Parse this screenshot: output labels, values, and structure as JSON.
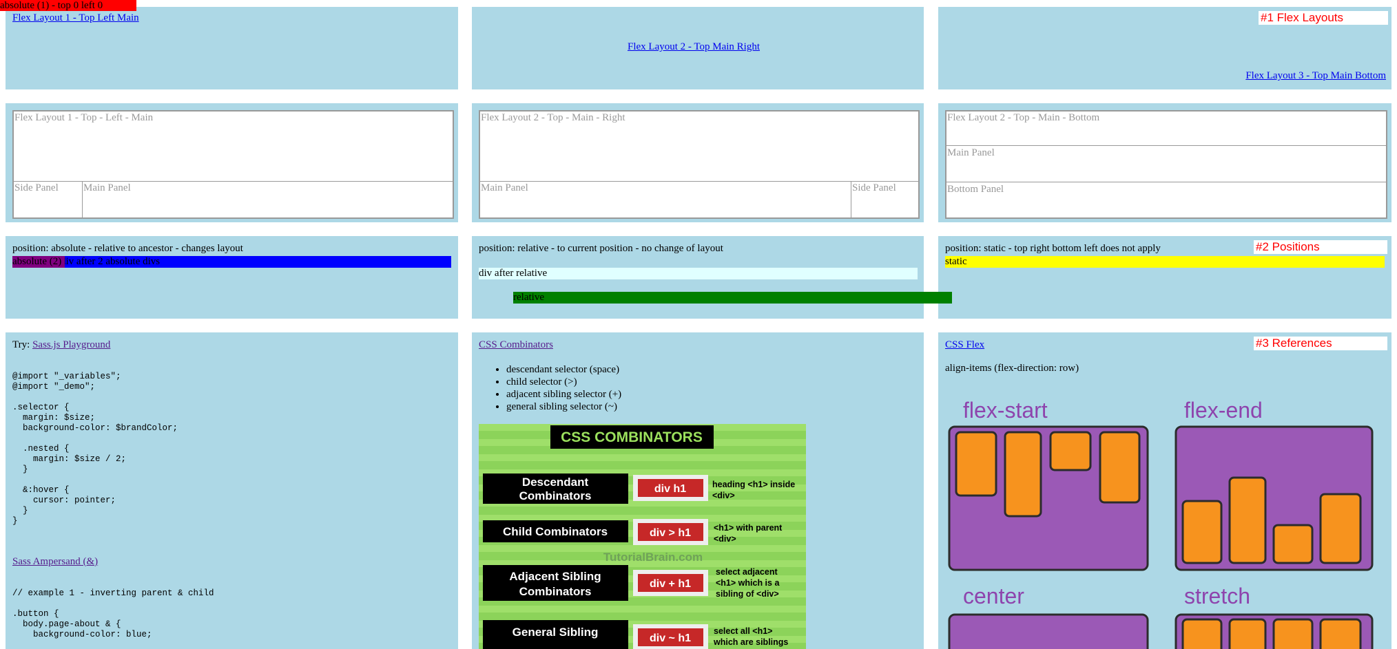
{
  "absolute_marker": "absolute (1) - top 0 left 0",
  "section_tags": {
    "flex": "#1 Flex Layouts",
    "positions": "#2 Positions",
    "references": "#3 References"
  },
  "flex_links": {
    "one": "Flex Layout 1 - Top Left Main",
    "two": "Flex Layout 2 - Top Main Right",
    "three": "Flex Layout 3 - Top Main Bottom"
  },
  "layouts": {
    "one": {
      "top": "Flex Layout 1 - Top - Left - Main",
      "side": "Side Panel",
      "main": "Main Panel"
    },
    "two": {
      "top": "Flex Layout 2 - Top - Main - Right",
      "main": "Main Panel",
      "side": "Side Panel"
    },
    "three": {
      "top": "Flex Layout 2 - Top - Main - Bottom",
      "main": "Main Panel",
      "bottom": "Bottom Panel"
    }
  },
  "positions": {
    "absolute": {
      "heading": "position: absolute - relative to ancestor - changes layout",
      "label": "absolute (2)",
      "after": "div after 2 absolute divs"
    },
    "relative": {
      "heading": "position: relative - to current position - no change of layout",
      "after": "div after relative",
      "label": "relative"
    },
    "static": {
      "heading": "position: static - top right bottom left does not apply",
      "label": "static"
    }
  },
  "sass": {
    "try_prefix": "Try:",
    "playground_link": "Sass.js Playground",
    "code1": "@import \"_variables\";\n@import \"_demo\";\n\n.selector {\n  margin: $size;\n  background-color: $brandColor;\n\n  .nested {\n    margin: $size / 2;\n  }\n\n  &:hover {\n    cursor: pointer;\n  }\n}",
    "ampersand_link": "Sass Ampersand (&)",
    "code2": "// example 1 - inverting parent & child\n\n.button {\n  body.page-about & {\n    background-color: blue;"
  },
  "combinators": {
    "link": "CSS Combinators",
    "items": [
      "descendant selector (space)",
      "child selector (>)",
      "adjacent sibling selector (+)",
      "general sibling selector (~)"
    ],
    "graphic": {
      "title": "CSS COMBINATORS",
      "watermark": "TutorialBrain.com",
      "rows": [
        {
          "name1": "Descendant",
          "name2": "Combinators",
          "code": "div h1",
          "desc1": "heading <h1> inside",
          "desc2": "<div>",
          "desc3": ""
        },
        {
          "name1": "Child Combinators",
          "name2": "",
          "code": "div > h1",
          "desc1": "<h1> with parent",
          "desc2": "<div>",
          "desc3": ""
        },
        {
          "name1": "Adjacent Sibling",
          "name2": "Combinators",
          "code": "div + h1",
          "desc1": "select adjacent",
          "desc2": "<h1> which is a",
          "desc3": "sibling of <div>"
        },
        {
          "name1": "General Sibling",
          "name2": "",
          "code": "div ~ h1",
          "desc1": "select all <h1>",
          "desc2": "which are siblings",
          "desc3": ""
        }
      ]
    }
  },
  "flexref": {
    "link": "CSS Flex",
    "subtitle": "align-items (flex-direction: row)",
    "labels": {
      "flex_start": "flex-start",
      "flex_end": "flex-end",
      "center": "center",
      "stretch": "stretch"
    }
  },
  "colors": {
    "panel_bg": "#add8e6",
    "red_tag": "#ff0000",
    "absolute_blue": "#0000ff",
    "absolute_purple": "#800080",
    "relative_green": "#008000",
    "after_relative_bg": "#e0ffff",
    "static_yellow": "#ffff00",
    "graphic_green": "#8cd35a",
    "graphic_red": "#c62828",
    "flex_purple": "#9b59b6",
    "flex_orange": "#f7931e"
  }
}
